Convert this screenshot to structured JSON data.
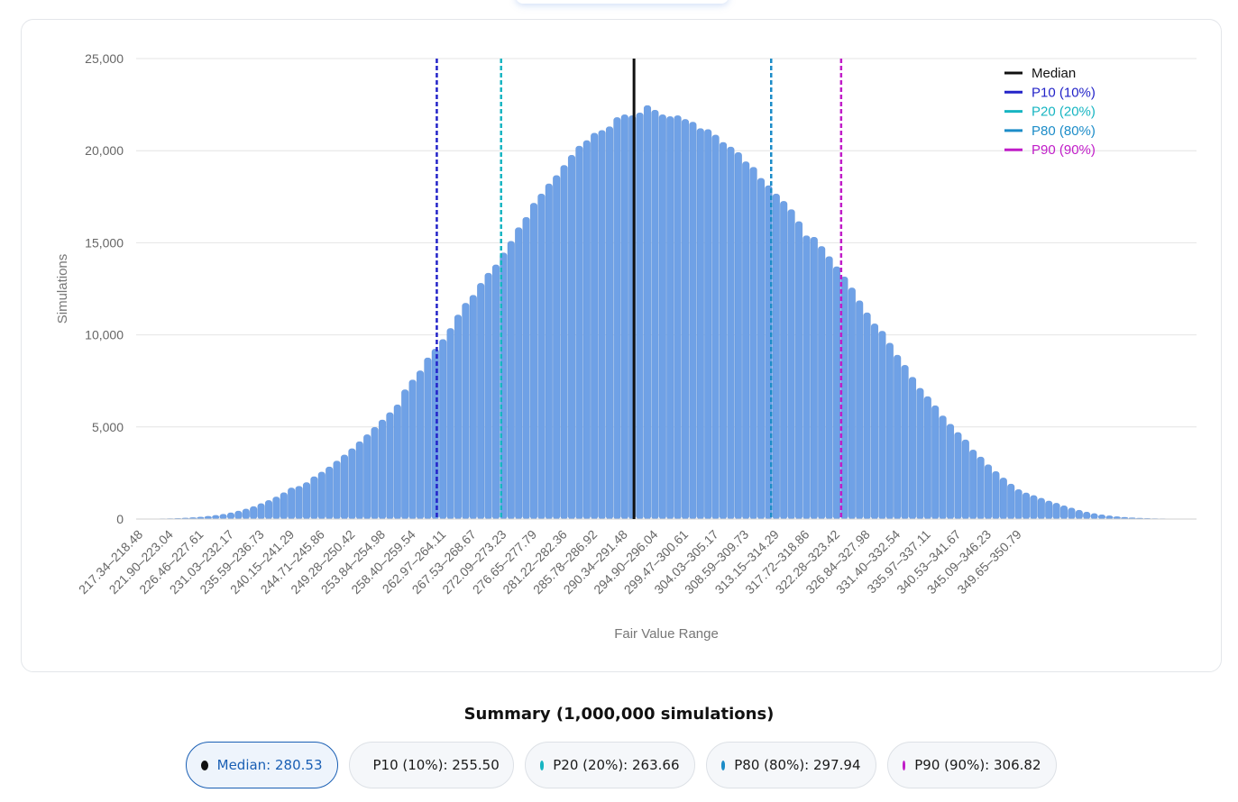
{
  "chart_data": {
    "type": "bar",
    "xlabel": "Fair Value Range",
    "ylabel": "Simulations",
    "ylim": [
      0,
      25000
    ],
    "yticks": [
      0,
      5000,
      10000,
      15000,
      20000,
      25000
    ],
    "ytick_labels": [
      "0",
      "5,000",
      "10,000",
      "15,000",
      "20,000",
      "25,000"
    ],
    "grid": true,
    "legend_position": "top-right",
    "x_range": [
      217.34,
      351.93
    ],
    "bin_count": 118,
    "category_labels": [
      "217.34–218.48",
      "221.90–223.04",
      "226.46–227.61",
      "231.03–232.17",
      "235.59–236.73",
      "240.15–241.29",
      "244.71–245.86",
      "249.28–250.42",
      "253.84–254.98",
      "258.40–259.54",
      "262.97–264.11",
      "267.53–268.67",
      "272.09–273.23",
      "276.65–277.79",
      "281.22–282.36",
      "285.78–286.92",
      "290.34–291.48",
      "294.90–296.04",
      "299.47–300.61",
      "304.03–305.17",
      "308.59–309.73",
      "313.15–314.29",
      "317.72–318.86",
      "322.28–323.42",
      "326.84–327.98",
      "331.40–332.54",
      "335.97–337.11",
      "340.53–341.67",
      "345.09–346.23",
      "349.65–350.79"
    ],
    "values": [
      5,
      8,
      12,
      18,
      26,
      38,
      55,
      78,
      108,
      150,
      200,
      262,
      340,
      435,
      545,
      680,
      840,
      1010,
      1200,
      1430,
      1690,
      1780,
      1980,
      2300,
      2550,
      2830,
      3150,
      3480,
      3820,
      4200,
      4580,
      4980,
      5380,
      5780,
      6200,
      7020,
      7550,
      8050,
      8750,
      9230,
      9750,
      10350,
      11080,
      11720,
      12150,
      12800,
      13350,
      13800,
      14450,
      15080,
      15820,
      16380,
      17150,
      17650,
      18200,
      18650,
      19200,
      19750,
      20250,
      20550,
      20950,
      21100,
      21300,
      21800,
      21950,
      21900,
      22050,
      22450,
      22200,
      21950,
      21850,
      21900,
      21700,
      21550,
      21200,
      21150,
      20850,
      20450,
      20200,
      19900,
      19400,
      19100,
      18500,
      18100,
      17650,
      17250,
      16800,
      16150,
      15380,
      15300,
      14800,
      14250,
      13700,
      13150,
      12550,
      11850,
      11200,
      10600,
      10200,
      9550,
      8900,
      8350,
      7700,
      7100,
      6650,
      6150,
      5600,
      5150,
      4700,
      4300,
      3750,
      3370,
      2950,
      2580,
      2230,
      1900,
      1600,
      1420
    ],
    "tail_values": [
      1280,
      1130,
      980,
      860,
      720,
      600,
      480,
      380,
      300,
      230,
      175,
      130,
      95,
      70,
      50,
      35,
      25,
      18,
      12,
      8,
      5,
      3
    ],
    "markers": [
      {
        "name": "Median",
        "value": 280.53,
        "color": "#111111",
        "style": "solid"
      },
      {
        "name": "P10 (10%)",
        "value": 255.5,
        "color": "#2323c8",
        "style": "dashed"
      },
      {
        "name": "P20 (20%)",
        "value": 263.66,
        "color": "#17b5c2",
        "style": "dashed"
      },
      {
        "name": "P80 (80%)",
        "value": 297.94,
        "color": "#1c8cc8",
        "style": "dashed"
      },
      {
        "name": "P90 (90%)",
        "value": 306.82,
        "color": "#c01cc8",
        "style": "dashed"
      }
    ],
    "bar_color": "#6fa1e6",
    "bar_edge_color": "#5b8fd8"
  },
  "summary": {
    "title": "Summary (1,000,000 simulations)",
    "items": [
      {
        "label": "Median: 280.53",
        "color": "#111111"
      },
      {
        "label": "P10 (10%): 255.50",
        "color": "#2323c8"
      },
      {
        "label": "P20 (20%): 263.66",
        "color": "#17b5c2"
      },
      {
        "label": "P80 (80%): 297.94",
        "color": "#1c8cc8"
      },
      {
        "label": "P90 (90%): 306.82",
        "color": "#c01cc8"
      }
    ]
  }
}
